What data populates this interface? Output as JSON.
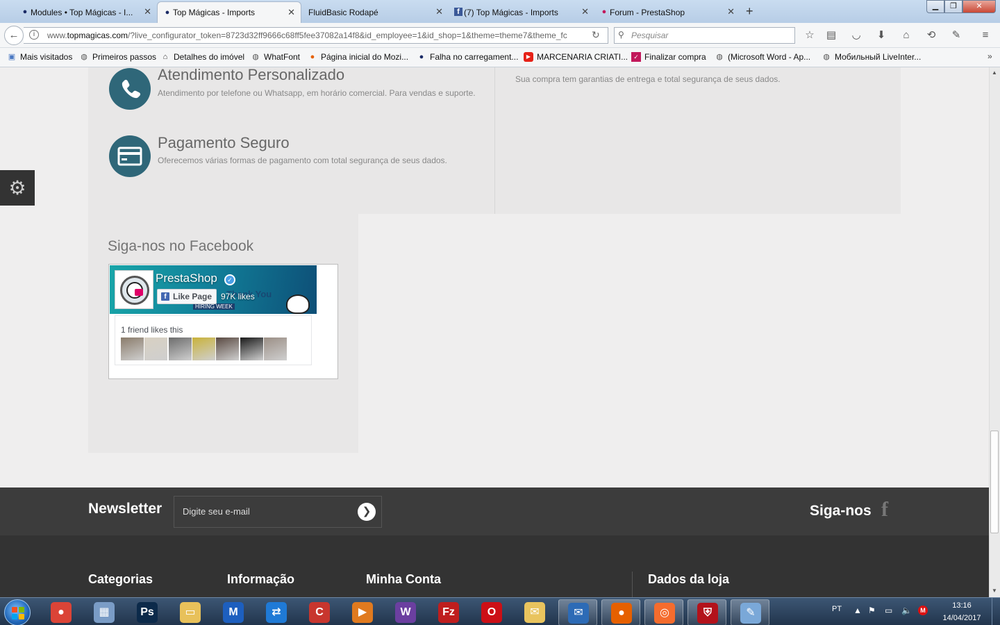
{
  "browser": {
    "tabs": [
      {
        "label": "Modules • Top Mágicas - I...",
        "active": false
      },
      {
        "label": "Top Mágicas - Imports",
        "active": true
      },
      {
        "label": "FluidBasic Rodapé",
        "active": false
      },
      {
        "label": "(7) Top Mágicas - Imports",
        "active": false
      },
      {
        "label": "Forum - PrestaShop",
        "active": false
      }
    ],
    "url_prefix": "www.",
    "url_host": "topmagicas.com",
    "url_rest": "/?live_configurator_token=8723d32ff9666c68ff5fee37082a14f8&id_employee=1&id_shop=1&theme=theme7&theme_fc",
    "search_placeholder": "Pesquisar",
    "bookmarks": [
      "Mais visitados",
      "Primeiros passos",
      "Detalhes do imóvel",
      "WhatFont",
      "Página inicial do Mozi...",
      "Falha no carregament...",
      "MARCENARIA CRIATI...",
      "Finalizar compra",
      "(Microsoft Word - Ap...",
      "Мобильный LiveInter..."
    ],
    "bookmarks_overflow": "»"
  },
  "page": {
    "features": [
      {
        "title": "Atendimento Personalizado",
        "desc": "Atendimento por telefone ou Whatsapp, em horário comercial. Para vendas e suporte."
      },
      {
        "title": "Pagamento Seguro",
        "desc": "Oferecemos várias formas de pagamento com total segurança de seus dados."
      }
    ],
    "right_desc": "Sua compra tem garantias de entrega e total segurança de seus dados.",
    "facebook": {
      "heading": "Siga-nos no Facebook",
      "page_name": "PrestaShop",
      "like_button": "Like Page",
      "likes": "97K likes",
      "cover_text": "Thank You",
      "hiring": "HIRING WEEK",
      "friends_text": "1 friend likes this",
      "friend_count": 7
    },
    "newsletter": {
      "title": "Newsletter",
      "placeholder": "Digite seu e-mail",
      "submit": "❯"
    },
    "social_title": "Siga-nos",
    "social_icon": "f",
    "footer_headings": [
      "Categorias",
      "Informação",
      "Minha Conta",
      "Dados da loja"
    ]
  },
  "taskbar": {
    "lang": "PT",
    "time": "13:16",
    "date": "14/04/2017",
    "apps": [
      "chrome",
      "calculator",
      "photoshop",
      "explorer",
      "malwarebytes",
      "teamviewer",
      "ccleaner",
      "media-player",
      "winrar",
      "filezilla",
      "opera",
      "mail",
      "thunderbird",
      "firefox",
      "origin",
      "antivirus",
      "paint"
    ]
  },
  "colors": {
    "accent_circle": "#2f6779",
    "footer_dark": "#333333",
    "newsletter_bar": "#3c3c3c",
    "facebook_blue": "#4267b2"
  }
}
